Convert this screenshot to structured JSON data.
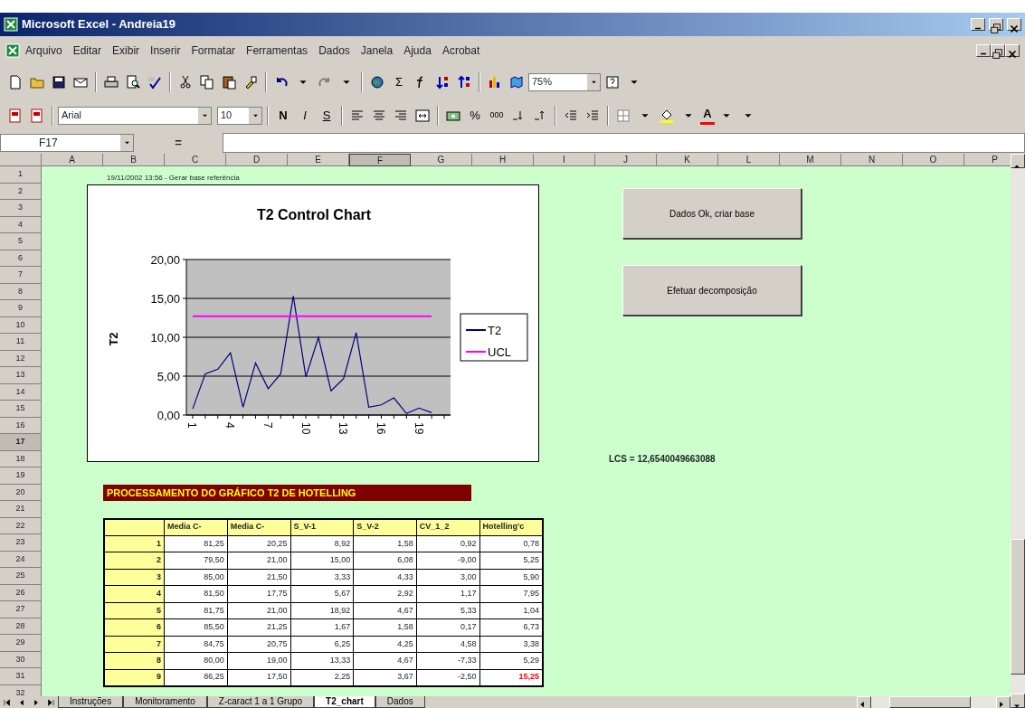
{
  "window": {
    "title": "Microsoft Excel - Andreia19"
  },
  "menu": [
    "Arquivo",
    "Editar",
    "Exibir",
    "Inserir",
    "Formatar",
    "Ferramentas",
    "Dados",
    "Janela",
    "Ajuda",
    "Acrobat"
  ],
  "standard_toolbar": {
    "sum": "Σ",
    "zoom": "75%"
  },
  "formatting_toolbar": {
    "font": "Arial",
    "size": "10",
    "bold": "N",
    "italic": "I",
    "underline": "S",
    "percent": "%",
    "thousands": "000",
    "font_color": "A"
  },
  "formula_bar": {
    "name_box": "F17",
    "equals": "="
  },
  "columns": [
    {
      "label": "A",
      "selected": false
    },
    {
      "label": "B",
      "selected": false
    },
    {
      "label": "C",
      "selected": false
    },
    {
      "label": "D",
      "selected": false
    },
    {
      "label": "E",
      "selected": false
    },
    {
      "label": "F",
      "selected": true
    },
    {
      "label": "G",
      "selected": false
    },
    {
      "label": "H",
      "selected": false
    },
    {
      "label": "I",
      "selected": false
    },
    {
      "label": "J",
      "selected": false
    },
    {
      "label": "K",
      "selected": false
    },
    {
      "label": "L",
      "selected": false
    },
    {
      "label": "M",
      "selected": false
    },
    {
      "label": "N",
      "selected": false
    },
    {
      "label": "O",
      "selected": false
    },
    {
      "label": "P",
      "selected": false
    }
  ],
  "rows": [
    {
      "label": "1",
      "selected": false
    },
    {
      "label": "2",
      "selected": false
    },
    {
      "label": "3",
      "selected": false
    },
    {
      "label": "4",
      "selected": false
    },
    {
      "label": "5",
      "selected": false
    },
    {
      "label": "6",
      "selected": false
    },
    {
      "label": "7",
      "selected": false
    },
    {
      "label": "8",
      "selected": false
    },
    {
      "label": "9",
      "selected": false
    },
    {
      "label": "10",
      "selected": false
    },
    {
      "label": "11",
      "selected": false
    },
    {
      "label": "12",
      "selected": false
    },
    {
      "label": "13",
      "selected": false
    },
    {
      "label": "14",
      "selected": false
    },
    {
      "label": "15",
      "selected": false
    },
    {
      "label": "16",
      "selected": false
    },
    {
      "label": "17",
      "selected": true
    },
    {
      "label": "18",
      "selected": false
    },
    {
      "label": "19",
      "selected": false
    },
    {
      "label": "20",
      "selected": false
    },
    {
      "label": "21",
      "selected": false
    },
    {
      "label": "22",
      "selected": false
    },
    {
      "label": "23",
      "selected": false
    },
    {
      "label": "24",
      "selected": false
    },
    {
      "label": "25",
      "selected": false
    },
    {
      "label": "26",
      "selected": false
    },
    {
      "label": "27",
      "selected": false
    },
    {
      "label": "28",
      "selected": false
    },
    {
      "label": "29",
      "selected": false
    },
    {
      "label": "30",
      "selected": false
    },
    {
      "label": "31",
      "selected": false
    },
    {
      "label": "32",
      "selected": false
    }
  ],
  "sheet": {
    "timestamp": "19/11/2002 13:56 - Gerar base referência",
    "chart": {
      "chart_data": {
        "type": "line",
        "title": "T2 Control Chart",
        "ylabel": "T2",
        "x": [
          1,
          2,
          3,
          4,
          5,
          6,
          7,
          8,
          9,
          10,
          11,
          12,
          13,
          14,
          15,
          16,
          17,
          18,
          19,
          20
        ],
        "xlim": [
          0.5,
          21.5
        ],
        "grid": true,
        "legend": "right",
        "series": [
          {
            "name": "T2",
            "color": "#000080",
            "values": [
              0.8,
              5.3,
              5.9,
              8.0,
              1.0,
              6.7,
              3.4,
              5.3,
              15.3,
              4.9,
              10.0,
              3.1,
              4.7,
              10.6,
              1.0,
              1.3,
              2.2,
              0.2,
              0.9,
              0.3
            ]
          },
          {
            "name": "UCL",
            "color": "#ff00ff",
            "values": [
              12.7,
              12.7,
              12.7,
              12.7,
              12.7,
              12.7,
              12.7,
              12.7,
              12.7,
              12.7,
              12.7,
              12.7,
              12.7,
              12.7,
              12.7,
              12.7,
              12.7,
              12.7,
              12.7,
              12.7
            ]
          }
        ],
        "xticks": [
          1,
          4,
          7,
          10,
          13,
          16,
          19
        ],
        "ylim": [
          0,
          20
        ],
        "yticks": [
          {
            "value": 0,
            "label": "0,00"
          },
          {
            "value": 5,
            "label": "5,00"
          },
          {
            "value": 10,
            "label": "10,00"
          },
          {
            "value": 15,
            "label": "15,00"
          },
          {
            "value": 20,
            "label": "20,00"
          }
        ]
      }
    },
    "buttons": [
      "Dados Ok, criar base",
      "Efetuar decomposição"
    ],
    "lcs": "LCS = 12,6540049663088",
    "section_title": "PROCESSAMENTO DO GRÁFICO T2 DE HOTELLING",
    "table": {
      "columns": [
        "Media C-",
        "Media C-",
        "S_V-1",
        "S_V-2",
        "CV_1_2",
        "Hotelling'c"
      ],
      "rows": [
        {
          "label": "1",
          "cells": [
            "81,25",
            "20,25",
            "8,92",
            "1,58",
            "0,92",
            "0,78"
          ],
          "over_limit": false
        },
        {
          "label": "2",
          "cells": [
            "79,50",
            "21,00",
            "15,00",
            "6,08",
            "-9,00",
            "5,25"
          ],
          "over_limit": false
        },
        {
          "label": "3",
          "cells": [
            "85,00",
            "21,50",
            "3,33",
            "4,33",
            "3,00",
            "5,90"
          ],
          "over_limit": false
        },
        {
          "label": "4",
          "cells": [
            "81,50",
            "17,75",
            "5,67",
            "2,92",
            "1,17",
            "7,95"
          ],
          "over_limit": false
        },
        {
          "label": "5",
          "cells": [
            "81,75",
            "21,00",
            "18,92",
            "4,67",
            "5,33",
            "1,04"
          ],
          "over_limit": false
        },
        {
          "label": "6",
          "cells": [
            "85,50",
            "21,25",
            "1,67",
            "1,58",
            "0,17",
            "6,73"
          ],
          "over_limit": false
        },
        {
          "label": "7",
          "cells": [
            "84,75",
            "20,75",
            "6,25",
            "4,25",
            "4,58",
            "3,38"
          ],
          "over_limit": false
        },
        {
          "label": "8",
          "cells": [
            "80,00",
            "19,00",
            "13,33",
            "4,67",
            "-7,33",
            "5,29"
          ],
          "over_limit": false
        },
        {
          "label": "9",
          "cells": [
            "86,25",
            "17,50",
            "2,25",
            "3,67",
            "-2,50",
            "15,25"
          ],
          "over_limit": true
        }
      ]
    }
  },
  "sheet_tabs": [
    {
      "label": "Instruções",
      "selected": false
    },
    {
      "label": "Monitoramento",
      "selected": false
    },
    {
      "label": "Z-caract 1 a 1 Grupo",
      "selected": false
    },
    {
      "label": "T2_chart",
      "selected": true
    },
    {
      "label": "Dados",
      "selected": false
    }
  ]
}
